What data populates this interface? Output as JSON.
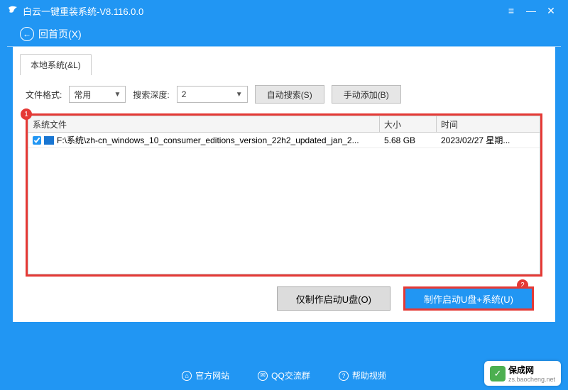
{
  "title": "白云一键重装系统-V8.116.0.0",
  "back_label": "回首页(X)",
  "tab_label": "本地系统(&L)",
  "controls": {
    "file_format_label": "文件格式:",
    "file_format_value": "常用",
    "search_depth_label": "搜索深度:",
    "search_depth_value": "2",
    "auto_search": "自动搜索(S)",
    "manual_add": "手动添加(B)"
  },
  "table": {
    "col_file": "系统文件",
    "col_size": "大小",
    "col_time": "时间",
    "rows": [
      {
        "checked": true,
        "path": "F:\\系统\\zh-cn_windows_10_consumer_editions_version_22h2_updated_jan_2...",
        "size": "5.68 GB",
        "time": "2023/02/27 星期..."
      }
    ]
  },
  "marker1": "1",
  "marker2": "2",
  "btn_make_only": "仅制作启动U盘(O)",
  "btn_make_system": "制作启动U盘+系统(U)",
  "footer": {
    "site": "官方网站",
    "qq": "QQ交流群",
    "help": "帮助视频"
  },
  "watermark": {
    "name": "保成网",
    "url": "zs.baocheng.net"
  }
}
